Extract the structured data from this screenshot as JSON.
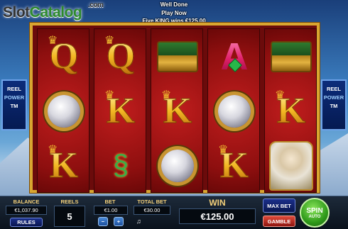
{
  "brand": {
    "part1": "Slot",
    "part2": "Catalog",
    "suffix": ".com"
  },
  "messages": [
    "Well Done",
    "Play Now",
    "Five KING wins €125.00"
  ],
  "side_panel": {
    "line1": "REEL",
    "line2": "POWER",
    "tm": "TM"
  },
  "reels": [
    [
      "Q",
      "pearl",
      "K"
    ],
    [
      "Q",
      "K",
      "dragon"
    ],
    [
      "chest",
      "K",
      "pearl"
    ],
    [
      "A",
      "pearl",
      "K"
    ],
    [
      "chest",
      "K",
      "sage"
    ]
  ],
  "controls": {
    "balance_label": "BALANCE",
    "balance_value": "€1,037.90",
    "rules_label": "RULES",
    "reels_label": "REELS",
    "reels_value": "5",
    "bet_label": "BET",
    "bet_value": "€1.00",
    "minus": "−",
    "plus": "+",
    "total_bet_label": "TOTAL BET",
    "total_bet_value": "€30.00",
    "win_label": "WIN",
    "win_value": "€125.00",
    "max_bet_label": "MAX BET",
    "gamble_label": "GAMBLE",
    "spin_label": "SPIN",
    "auto_label": "AUTO"
  },
  "colors": {
    "frame_gold": "#d9a630",
    "reel_red": "#a01414",
    "spin_green": "#2f9a1a",
    "label_gold": "#f3d07a"
  }
}
